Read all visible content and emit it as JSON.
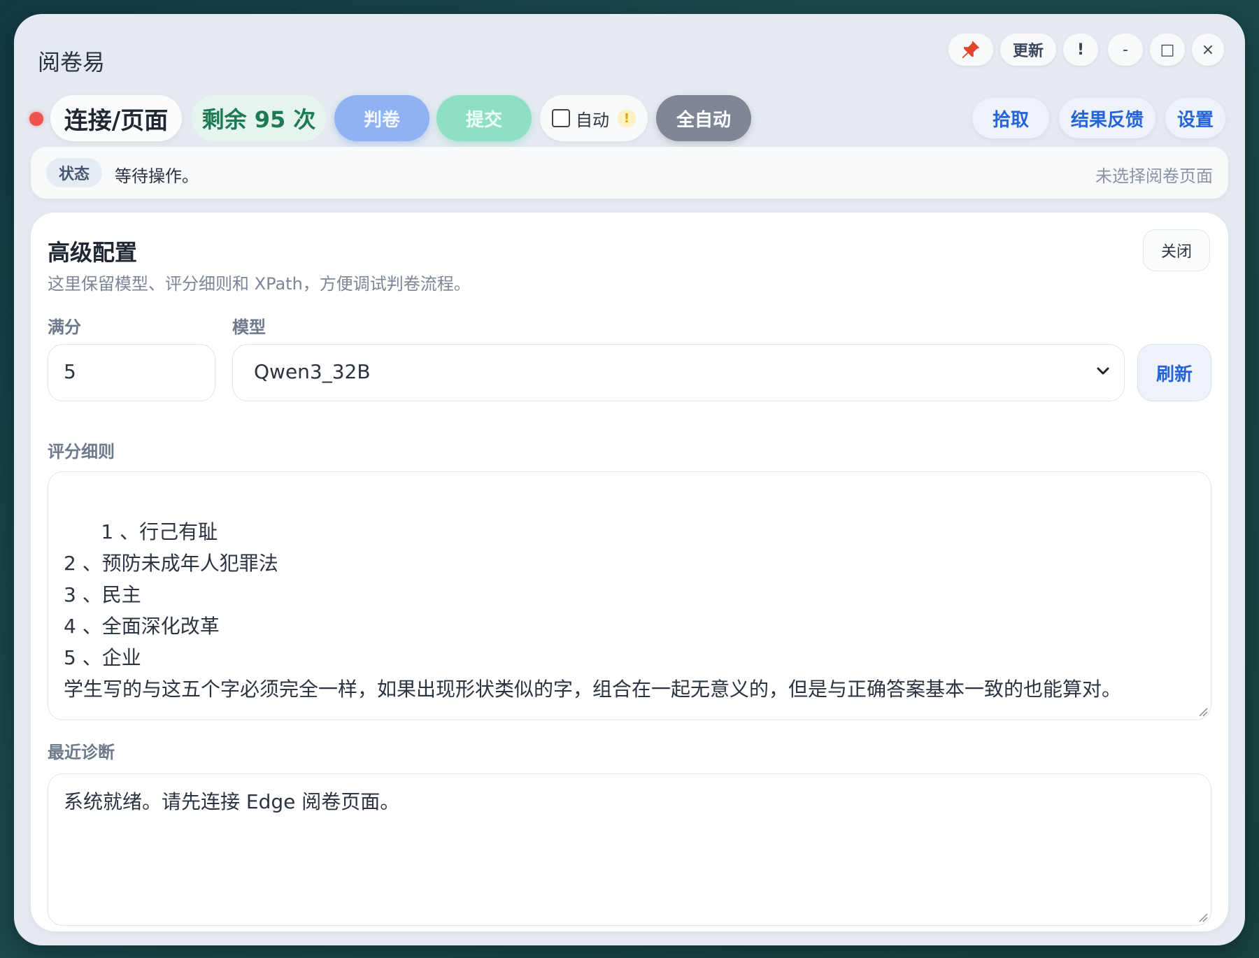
{
  "window": {
    "title": "阅卷易"
  },
  "window_controls": {
    "pin_icon": "pushpin-icon",
    "update_label": "更新",
    "alert_label": "!",
    "minimize_label": "-",
    "maximize_label": "□",
    "close_label": "×"
  },
  "toolbar": {
    "status_dot_color": "#f0524d",
    "connect_label": "连接/页面",
    "remaining_label": "剩余 95 次",
    "judge_label": "判卷",
    "submit_label": "提交",
    "auto_label": "自动",
    "auto_checked": false,
    "auto_warning": "!",
    "full_auto_label": "全自动",
    "pick_label": "拾取",
    "feedback_label": "结果反馈",
    "settings_label": "设置"
  },
  "status": {
    "tag": "状态",
    "text": "等待操作。",
    "right_text": "未选择阅卷页面"
  },
  "panel": {
    "title": "高级配置",
    "subtitle": "这里保留模型、评分细则和 XPath，方便调试判卷流程。",
    "close_label": "关闭",
    "score_label": "满分",
    "score_value": "5",
    "model_label": "模型",
    "model_value": "Qwen3_32B",
    "refresh_label": "刷新",
    "rules_label": "评分细则",
    "rules_text": "1 、行己有耻\n2 、预防未成年人犯罪法\n3 、民主\n4 、全面深化改革\n5 、企业\n学生写的与这五个字必须完全一样，如果出现形状类似的字，组合在一起无意义的，但是与正确答案基本一致的也能算对。",
    "diag_label": "最近诊断",
    "diag_text": "系统就绪。请先连接 Edge 阅卷页面。"
  }
}
